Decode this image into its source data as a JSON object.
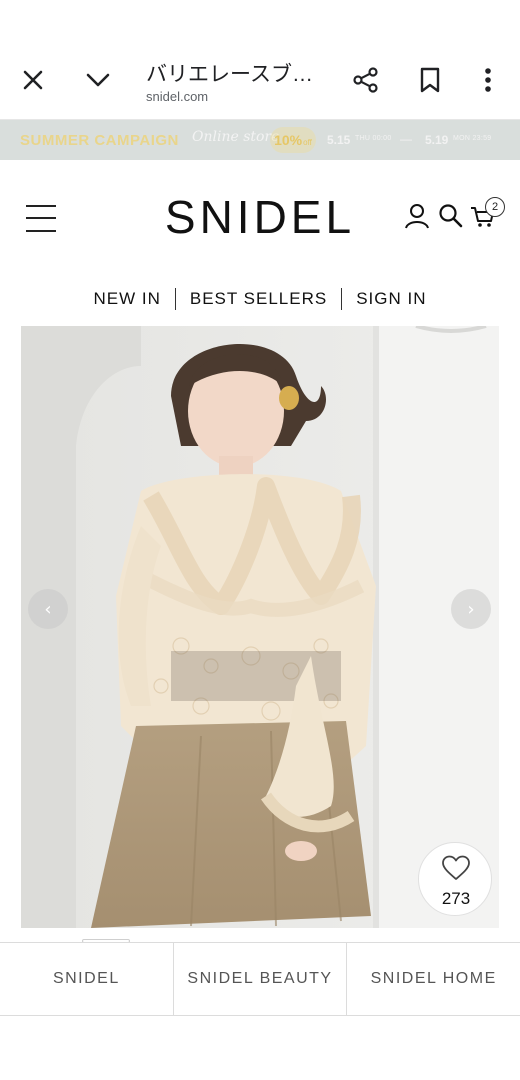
{
  "browser": {
    "title": "バリエレースブ…",
    "url": "snidel.com",
    "icons": {
      "close": "close-icon",
      "chevron": "chevron-down-icon",
      "share": "share-icon",
      "bookmark": "bookmark-icon",
      "more": "more-vert-icon"
    }
  },
  "campaign": {
    "title": "SUMMER CAMPAIGN",
    "script": "Online store",
    "off_pct": "10%",
    "off_word": "off",
    "start_date": "5.15",
    "start_day": "THU 00:00",
    "dash": "—",
    "end_date": "5.19",
    "end_day": "MON 23:59",
    "colors": {
      "banner_bg": "#d9dedc",
      "title": "#e9d58b"
    }
  },
  "header": {
    "logo": "SNIDEL",
    "cart_count": "2",
    "icons": {
      "menu": "menu-icon",
      "user": "user-icon",
      "search": "search-icon",
      "cart": "cart-icon"
    }
  },
  "subnav": {
    "items": [
      "NEW IN",
      "BEST SELLERS",
      "SIGN IN"
    ]
  },
  "hero": {
    "prev_label": "‹",
    "next_label": "›",
    "favorite_count": "273"
  },
  "bottom_tabs": {
    "items": [
      "SNIDEL",
      "SNIDEL BEAUTY",
      "SNIDEL HOME"
    ]
  }
}
